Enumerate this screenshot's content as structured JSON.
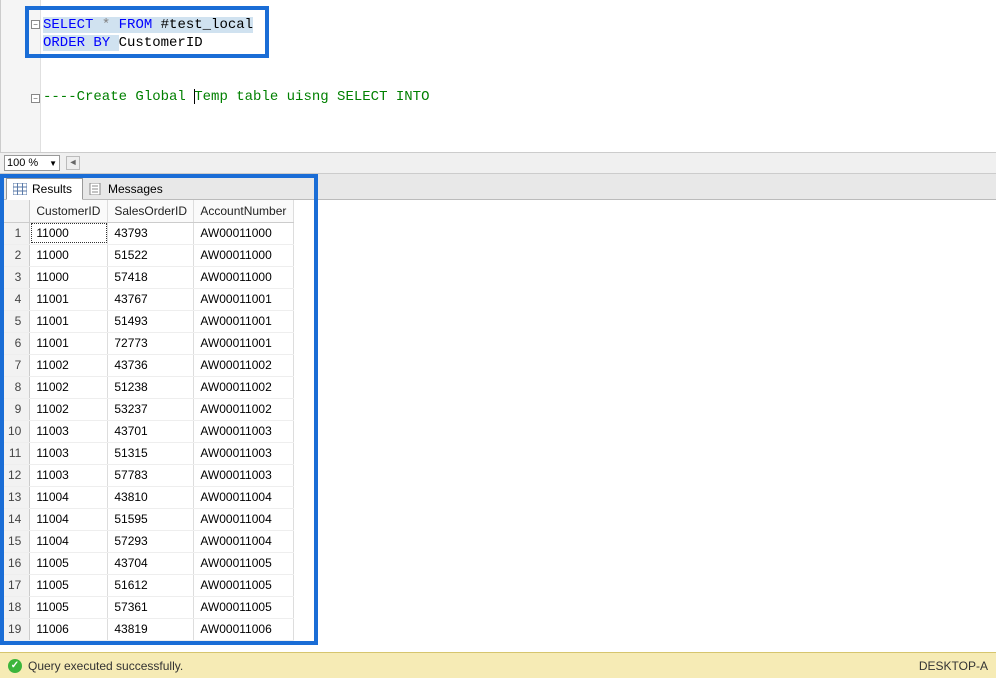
{
  "editor": {
    "line1_select": "SELECT",
    "line1_star": " * ",
    "line1_from": "FROM",
    "line1_table": " #test_local",
    "line2_order": "ORDER BY ",
    "line2_col": "CustomerID",
    "comment_prefix": "----Create Global ",
    "comment_rest": "Temp table uisng SELECT INTO"
  },
  "zoom": {
    "value": "100 %"
  },
  "tabs": {
    "results": "Results",
    "messages": "Messages"
  },
  "grid": {
    "columns": [
      "CustomerID",
      "SalesOrderID",
      "AccountNumber"
    ],
    "rows": [
      [
        "11000",
        "43793",
        "AW00011000"
      ],
      [
        "11000",
        "51522",
        "AW00011000"
      ],
      [
        "11000",
        "57418",
        "AW00011000"
      ],
      [
        "11001",
        "43767",
        "AW00011001"
      ],
      [
        "11001",
        "51493",
        "AW00011001"
      ],
      [
        "11001",
        "72773",
        "AW00011001"
      ],
      [
        "11002",
        "43736",
        "AW00011002"
      ],
      [
        "11002",
        "51238",
        "AW00011002"
      ],
      [
        "11002",
        "53237",
        "AW00011002"
      ],
      [
        "11003",
        "43701",
        "AW00011003"
      ],
      [
        "11003",
        "51315",
        "AW00011003"
      ],
      [
        "11003",
        "57783",
        "AW00011003"
      ],
      [
        "11004",
        "43810",
        "AW00011004"
      ],
      [
        "11004",
        "51595",
        "AW00011004"
      ],
      [
        "11004",
        "57293",
        "AW00011004"
      ],
      [
        "11005",
        "43704",
        "AW00011005"
      ],
      [
        "11005",
        "51612",
        "AW00011005"
      ],
      [
        "11005",
        "57361",
        "AW00011005"
      ],
      [
        "11006",
        "43819",
        "AW00011006"
      ]
    ]
  },
  "status": {
    "message": "Query executed successfully.",
    "server": "DESKTOP-A"
  }
}
